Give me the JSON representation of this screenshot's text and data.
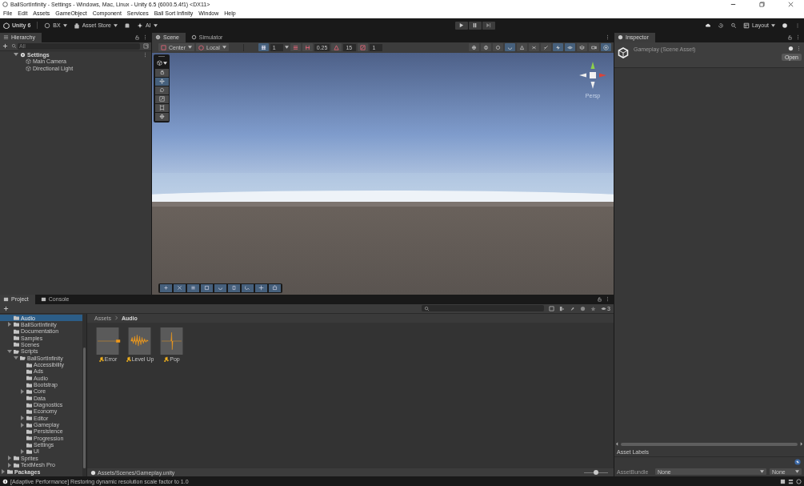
{
  "window": {
    "title": "BallSortInfinity - Settings - Windows, Mac, Linux - Unity 6.5 (6000.5.4f1) <DX11>"
  },
  "menu": [
    "File",
    "Edit",
    "Assets",
    "GameObject",
    "Component",
    "Services",
    "Ball Sort Infinity",
    "Window",
    "Help"
  ],
  "toolbar": {
    "account": "Unity 6",
    "user": "BX",
    "store": "Asset Store",
    "ai": "AI",
    "layout": "Layout"
  },
  "hierarchy": {
    "tab": "Hierarchy",
    "search_placeholder": "All",
    "scene": {
      "label": "Settings",
      "expanded": true,
      "children": [
        {
          "label": "Main Camera"
        },
        {
          "label": "Directional Light"
        }
      ]
    }
  },
  "scene_tabs": [
    {
      "label": "Scene",
      "selected": true
    },
    {
      "label": "Simulator",
      "selected": false
    }
  ],
  "scene_toolbar": {
    "pivot": "Center",
    "space": "Local",
    "grid_size": "1",
    "snap_move": "0.25",
    "snap_rotate": "15",
    "snap_scale": "1",
    "toggles": [
      {
        "kind": "wire",
        "selected": false
      },
      {
        "kind": "sun",
        "selected": false
      },
      {
        "kind": "sphere",
        "selected": false
      },
      {
        "kind": "ring",
        "selected": true
      },
      {
        "kind": "fx",
        "selected": false
      },
      {
        "kind": "cut",
        "selected": false
      },
      {
        "kind": "slash",
        "selected": false
      },
      {
        "kind": "pivot",
        "selected": true
      },
      {
        "kind": "eye",
        "selected": true
      },
      {
        "kind": "layers",
        "selected": false
      },
      {
        "kind": "camera",
        "selected": false
      },
      {
        "kind": "gizmos",
        "selected": true
      }
    ]
  },
  "tools": [
    {
      "kind": "hand",
      "selected": false
    },
    {
      "kind": "move",
      "selected": true
    },
    {
      "kind": "rotate",
      "selected": false
    },
    {
      "kind": "scale",
      "selected": false
    },
    {
      "kind": "rect",
      "selected": false
    },
    {
      "kind": "transform",
      "selected": false
    }
  ],
  "gizmo": {
    "label": "Persp"
  },
  "inspector": {
    "tab": "Inspector",
    "title": "Gameplay (Scene Asset)",
    "open_button": "Open",
    "labels_heading": "Asset Labels",
    "bundle_label": "AssetBundle",
    "bundle_name": "None",
    "bundle_variant": "None"
  },
  "bottom_tabs": [
    {
      "label": "Project",
      "selected": true
    },
    {
      "label": "Console",
      "selected": false
    }
  ],
  "project": {
    "tree": [
      {
        "label": "Audio",
        "selected": true
      },
      {
        "label": "BallSortInfinity",
        "selected": false,
        "expanded": false
      },
      {
        "label": "Documentation",
        "selected": false
      },
      {
        "label": "Samples",
        "selected": false
      },
      {
        "label": "Scenes",
        "selected": false
      },
      {
        "label": "Scripts",
        "selected": false,
        "expanded": true,
        "children": [
          {
            "label": "BallSortInfinity",
            "selected": false,
            "expanded": true,
            "children": [
              {
                "label": "Accessibility",
                "selected": false
              },
              {
                "label": "Ads",
                "selected": false
              },
              {
                "label": "Audio",
                "selected": false
              },
              {
                "label": "Bootstrap",
                "selected": false
              },
              {
                "label": "Core",
                "selected": false,
                "expanded": false
              },
              {
                "label": "Data",
                "selected": false
              },
              {
                "label": "Diagnostics",
                "selected": false
              },
              {
                "label": "Economy",
                "selected": false
              },
              {
                "label": "Editor",
                "selected": false,
                "expanded": false
              },
              {
                "label": "Gameplay",
                "selected": false,
                "expanded": false
              },
              {
                "label": "Persistence",
                "selected": false
              },
              {
                "label": "Progression",
                "selected": false
              },
              {
                "label": "Settings",
                "selected": false
              },
              {
                "label": "UI",
                "selected": false,
                "expanded": false
              }
            ]
          }
        ]
      },
      {
        "label": "Sprites",
        "selected": false,
        "expanded": false
      },
      {
        "label": "TextMesh Pro",
        "selected": false,
        "expanded": false
      }
    ],
    "packages": {
      "label": "Packages",
      "expanded": false
    },
    "breadcrumb": [
      "Assets",
      "Audio"
    ],
    "assets": [
      {
        "label": "Error",
        "kind": "blip"
      },
      {
        "label": "Level Up",
        "kind": "burst"
      },
      {
        "label": "Pop",
        "kind": "spike"
      }
    ],
    "hidden_count": "3",
    "selected_path": "Assets/Scenes/Gameplay.unity",
    "zoom": {
      "level": 0.5
    }
  },
  "status": "[Adaptive Performance] Restoring dynamic resolution scale factor to 1.0"
}
